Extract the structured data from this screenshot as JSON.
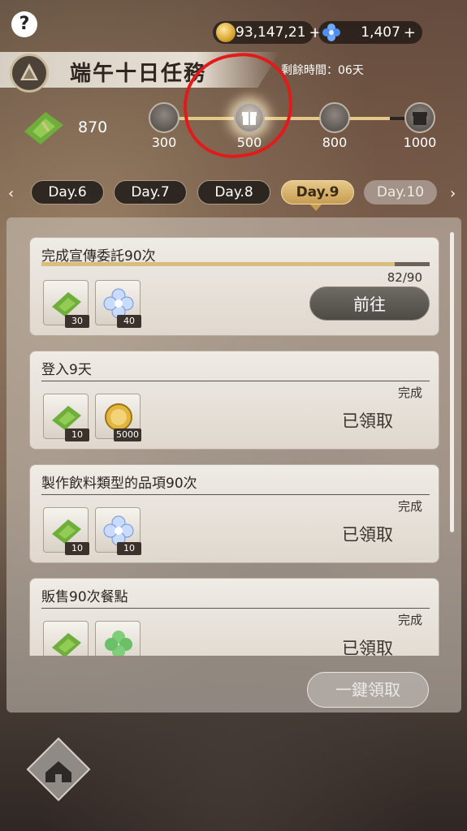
{
  "topbar": {
    "help_label": "?",
    "gold_value": "93,147,21",
    "gem_value": "1,407",
    "plus": "+"
  },
  "event": {
    "title": "端午十日任務",
    "time_remaining": "剩餘時間：06天",
    "points": "870",
    "milestones": [
      "300",
      "500",
      "800",
      "1000"
    ],
    "progress_fraction": 0.88
  },
  "days": {
    "tabs": [
      "Day.6",
      "Day.7",
      "Day.8",
      "Day.9",
      "Day.10"
    ],
    "active": "Day.9",
    "prev_arrow": "‹",
    "next_arrow": "›"
  },
  "tasks": [
    {
      "title": "完成宣傳委託90次",
      "progress_text": "82/90",
      "progress_fraction": 0.911,
      "rewards": [
        {
          "icon": "zongzi-icon",
          "qty": "30"
        },
        {
          "icon": "blue-flower-gem-icon",
          "qty": "40"
        }
      ],
      "action_label": "前往"
    },
    {
      "title": "登入9天",
      "status": "完成",
      "rewards": [
        {
          "icon": "zongzi-icon",
          "qty": "10"
        },
        {
          "icon": "gold-coin-icon",
          "qty": "5000"
        }
      ],
      "claimed_label": "已領取"
    },
    {
      "title": "製作飲料類型的品項90次",
      "status": "完成",
      "rewards": [
        {
          "icon": "zongzi-icon",
          "qty": "10"
        },
        {
          "icon": "blue-flower-gem-icon",
          "qty": "10"
        }
      ],
      "claimed_label": "已領取"
    },
    {
      "title": "販售90次餐點",
      "status": "完成",
      "rewards": [
        {
          "icon": "zongzi-icon",
          "qty": ""
        },
        {
          "icon": "clover-icon",
          "qty": ""
        }
      ],
      "claimed_label": "已領取"
    }
  ],
  "claim_all_label": "一鍵領取",
  "colors": {
    "accent_gold": "#d8bd7e",
    "annotation_red": "#e21a1a",
    "active_tab": "#c79d52"
  }
}
